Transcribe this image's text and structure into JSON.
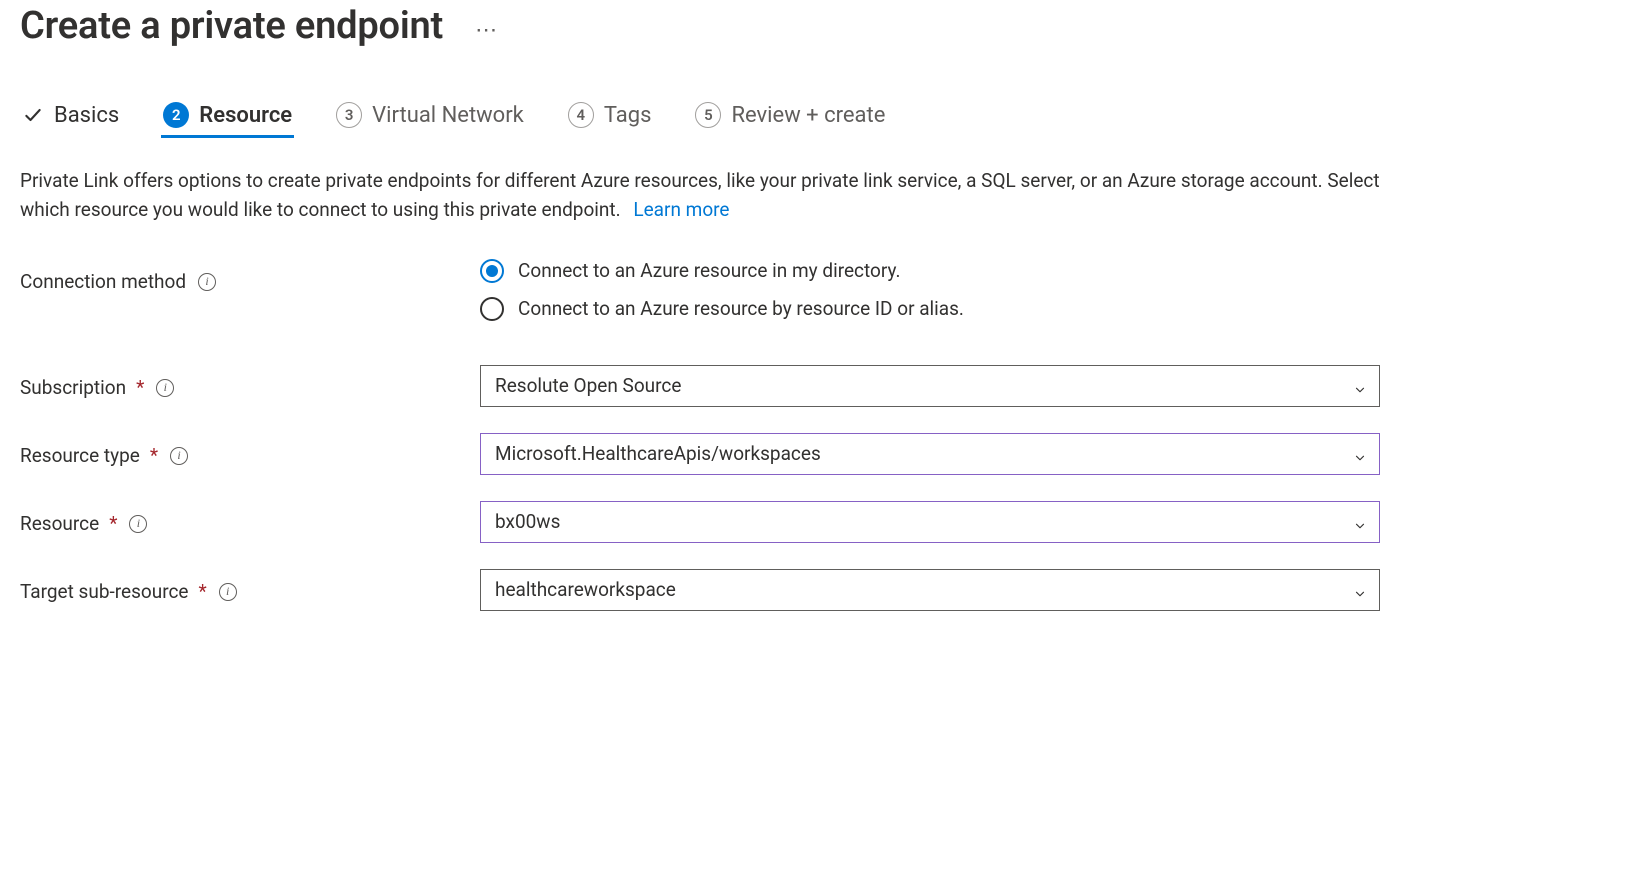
{
  "header": {
    "title": "Create a private endpoint",
    "more_label": "⋯"
  },
  "tabs": {
    "basics": "Basics",
    "resource": "Resource",
    "virtual_network": {
      "num": "3",
      "label": "Virtual Network"
    },
    "tags": {
      "num": "4",
      "label": "Tags"
    },
    "review": {
      "num": "5",
      "label": "Review + create"
    }
  },
  "desc": {
    "text": "Private Link offers options to create private endpoints for different Azure resources, like your private link service, a SQL server, or an Azure storage account. Select which resource you would like to connect to using this private endpoint.",
    "learn_more": "Learn more"
  },
  "fields": {
    "connection_method": {
      "label": "Connection method",
      "option_directory": "Connect to an Azure resource in my directory.",
      "option_alias": "Connect to an Azure resource by resource ID or alias."
    },
    "subscription": {
      "label": "Subscription",
      "value": "Resolute Open Source"
    },
    "resource_type": {
      "label": "Resource type",
      "value": "Microsoft.HealthcareApis/workspaces"
    },
    "resource": {
      "label": "Resource",
      "value": "bx00ws"
    },
    "target_sub": {
      "label": "Target sub-resource",
      "value": "healthcareworkspace"
    }
  },
  "step_active_num": "2"
}
